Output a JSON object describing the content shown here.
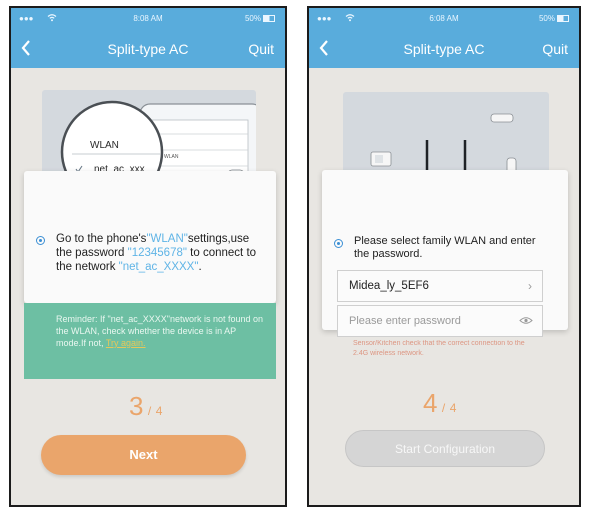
{
  "screens": [
    {
      "status": {
        "time": "8:08 AM",
        "battery": "50%"
      },
      "nav": {
        "back_icon": "chevron-left-icon",
        "title": "Split-type AC",
        "quit": "Quit"
      },
      "illustration": {
        "wlan_label": "WLAN",
        "network": "net_ac_xxx",
        "small_wlan": "WLAN",
        "small_item": "net_ac_xxx"
      },
      "instruction": {
        "part1": "Go to the phone's",
        "wlan": "\"WLAN\"",
        "part2": "settings,use",
        "part3": "the password",
        "password": "\"12345678\"",
        "part4": "to connect",
        "part5": "to the network",
        "network": "\"net_ac_XXXX\"",
        "part6": "."
      },
      "reminder": {
        "text": "Reminder: If \"net_ac_XXXX\"network is not found on the WLAN, check whether the device is in AP mode.If not,",
        "link": "Try again."
      },
      "step": {
        "current": "3",
        "total": "4"
      },
      "button": "Next"
    },
    {
      "status": {
        "time": "6:08 AM",
        "battery": "50%"
      },
      "nav": {
        "back_icon": "chevron-left-icon",
        "title": "Split-type AC",
        "quit": "Quit"
      },
      "instruction": "Please select family WLAN and enter the password.",
      "ssid": "Midea_ly_5EF6",
      "password_placeholder": "Please enter password",
      "note": "Sensor/Kitchen check that the correct connection to the 2.4G wireless network.",
      "step": {
        "current": "4",
        "total": "4"
      },
      "button": "Start Configuration"
    }
  ],
  "colors": {
    "header": "#59acdc",
    "accent_blue": "#5fb4e6",
    "next_button": "#eaa56b",
    "reminder": "#6dbfa3",
    "disabled_button": "#d5d5d5"
  }
}
